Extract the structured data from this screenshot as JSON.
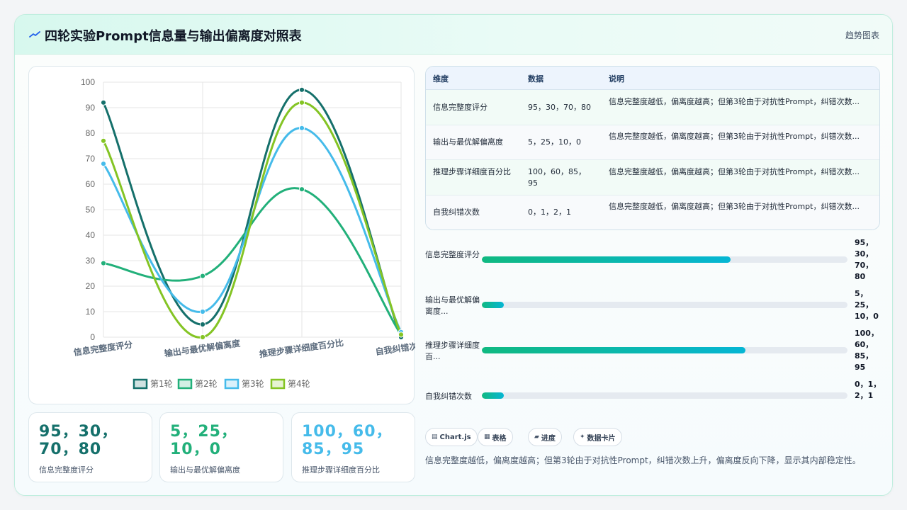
{
  "header": {
    "title": "四轮实验Prompt信息量与输出偏离度对照表",
    "link": "趋势图表"
  },
  "colors": {
    "series": [
      "#15706b",
      "#22b07a",
      "#45bbea",
      "#84c424"
    ],
    "stat_values": [
      "#15706b",
      "#22b07a",
      "#45bbea"
    ]
  },
  "chart_data": {
    "type": "line",
    "smooth": true,
    "categories": [
      "信息完整度评分",
      "输出与最优解偏离度",
      "推理步骤详细度百分比",
      "自我纠错次数"
    ],
    "series": [
      {
        "name": "第1轮",
        "values": [
          92,
          5,
          97,
          0
        ]
      },
      {
        "name": "第2轮",
        "values": [
          29,
          24,
          58,
          1
        ]
      },
      {
        "name": "第3轮",
        "values": [
          68,
          10,
          82,
          2
        ]
      },
      {
        "name": "第4轮",
        "values": [
          77,
          0,
          92,
          1
        ]
      }
    ],
    "ylim": [
      0,
      100
    ],
    "yticks": [
      0,
      10,
      20,
      30,
      40,
      50,
      60,
      70,
      80,
      90,
      100
    ],
    "grid": true,
    "legend": "bottom",
    "title": "",
    "xlabel": "",
    "ylabel": ""
  },
  "stats": [
    {
      "value": "95，30，70，80",
      "label": "信息完整度评分"
    },
    {
      "value": "5，25，10，0",
      "label": "输出与最优解偏离度"
    },
    {
      "value": "100，60，85，95",
      "label": "推理步骤详细度百分比"
    }
  ],
  "table": {
    "headers": [
      "维度",
      "数据",
      "说明"
    ],
    "rows": [
      {
        "dim": "信息完整度评分",
        "data": "95，30，70，80",
        "desc": "信息完整度越低，偏离度越高；但第3轮由于对抗性Prompt，纠错次数..."
      },
      {
        "dim": "输出与最优解偏离度",
        "data": "5，25，10，0",
        "desc": "信息完整度越低，偏离度越高；但第3轮由于对抗性Prompt，纠错次数..."
      },
      {
        "dim": "推理步骤详细度百分比",
        "data": "100，60，85，95",
        "desc": "信息完整度越低，偏离度越高；但第3轮由于对抗性Prompt，纠错次数..."
      },
      {
        "dim": "自我纠错次数",
        "data": "0，1，2，1",
        "desc": "信息完整度越低，偏离度越高；但第3轮由于对抗性Prompt，纠错次数..."
      }
    ]
  },
  "progress": [
    {
      "label": "信息完整度评分",
      "value": "95，30，70，80",
      "fill": 0.68
    },
    {
      "label": "输出与最优解偏离度...",
      "value": "5，25，10，0",
      "fill": 0.06
    },
    {
      "label": "推理步骤详细度百...",
      "value": "100，60，85，95",
      "fill": 0.72
    },
    {
      "label": "自我纠错次数",
      "value": "0，1，2，1",
      "fill": 0.06
    }
  ],
  "tags": [
    {
      "icon": "▤",
      "label": "Chart.js"
    },
    {
      "icon": "▦",
      "label": "表格"
    },
    {
      "icon": "▰",
      "label": "进度"
    },
    {
      "icon": "✦",
      "label": "数据卡片"
    }
  ],
  "note": "信息完整度越低，偏离度越高；但第3轮由于对抗性Prompt，纠错次数上升，偏离度反向下降，显示其内部稳定性。"
}
